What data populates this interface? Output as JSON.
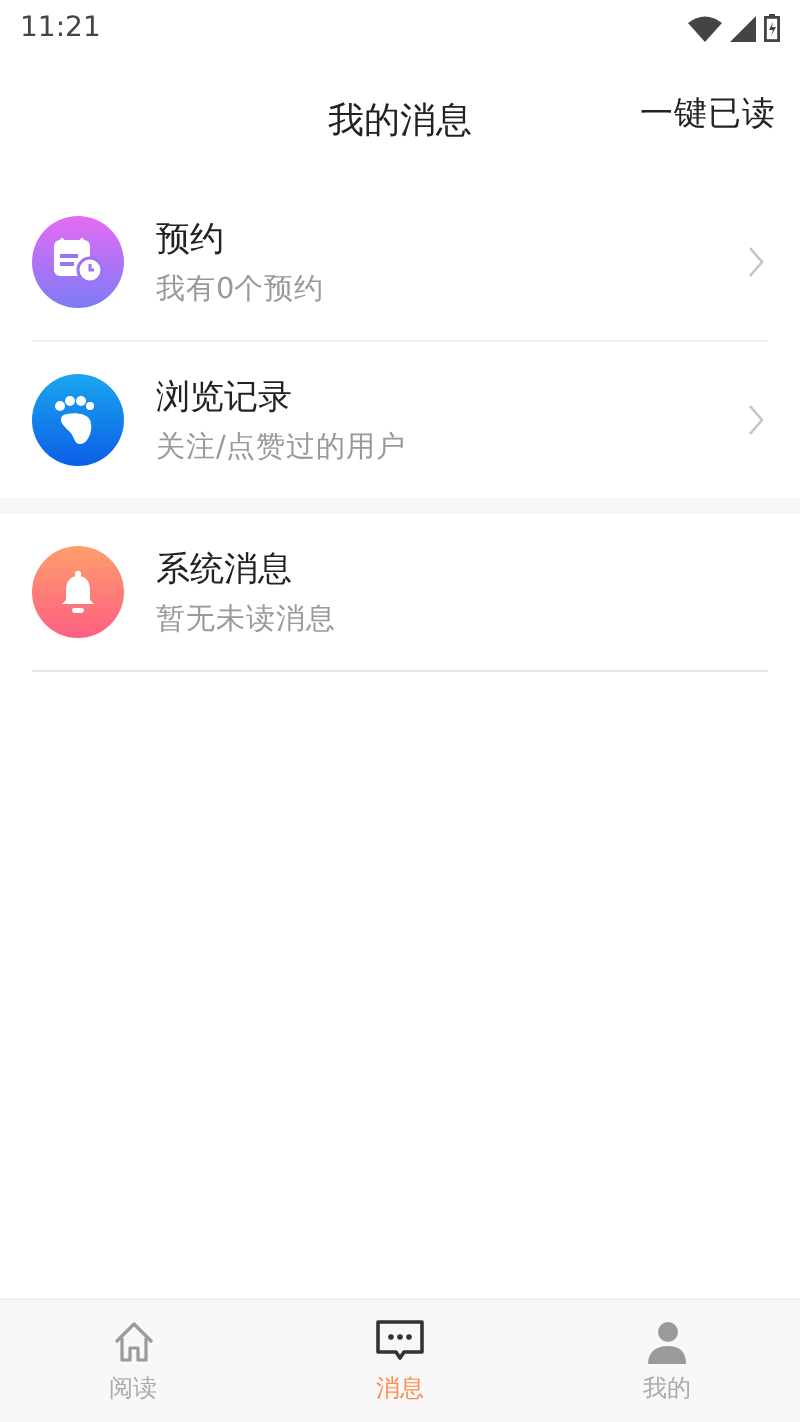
{
  "status_bar": {
    "time": "11:21"
  },
  "header": {
    "title": "我的消息",
    "action": "一键已读"
  },
  "groups": [
    {
      "items": [
        {
          "kind": "calendar",
          "title": "预约",
          "subtitle": "我有0个预约",
          "arrow": true
        },
        {
          "kind": "footprint",
          "title": "浏览记录",
          "subtitle": "关注/点赞过的用户",
          "arrow": true
        }
      ]
    },
    {
      "items": [
        {
          "kind": "bell",
          "title": "系统消息",
          "subtitle": "暂无未读消息",
          "arrow": false
        }
      ]
    }
  ],
  "tab_bar": [
    {
      "kind": "home",
      "label": "阅读",
      "selected": false
    },
    {
      "kind": "chat",
      "label": "消息",
      "selected": true
    },
    {
      "kind": "person",
      "label": "我的",
      "selected": false
    }
  ]
}
